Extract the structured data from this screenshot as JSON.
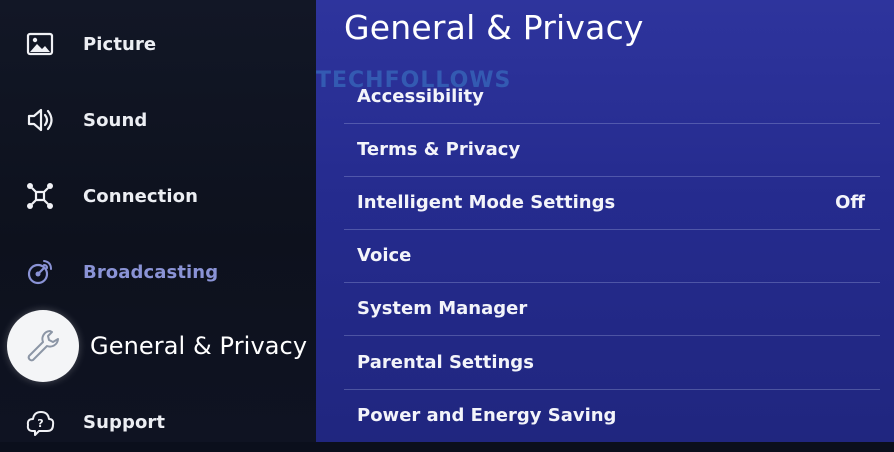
{
  "sidebar": {
    "items": [
      {
        "label": "Picture",
        "icon": "picture-icon"
      },
      {
        "label": "Sound",
        "icon": "speaker-icon"
      },
      {
        "label": "Connection",
        "icon": "network-icon"
      },
      {
        "label": "Broadcasting",
        "icon": "satellite-icon"
      },
      {
        "label": "General & Privacy",
        "icon": "wrench-icon"
      },
      {
        "label": "Support",
        "icon": "help-cloud-icon"
      }
    ]
  },
  "panel": {
    "title": "General & Privacy",
    "watermark": "TECHFOLLOWS",
    "options": [
      {
        "label": "Accessibility",
        "value": ""
      },
      {
        "label": "Terms & Privacy",
        "value": ""
      },
      {
        "label": "Intelligent Mode Settings",
        "value": "Off"
      },
      {
        "label": "Voice",
        "value": ""
      },
      {
        "label": "System Manager",
        "value": ""
      },
      {
        "label": "Parental Settings",
        "value": ""
      },
      {
        "label": "Power and Energy Saving",
        "value": ""
      }
    ]
  },
  "colors": {
    "panel_bg": "#2a309a",
    "sidebar_bg": "#10141f",
    "dim_label": "#8a93d6",
    "active_icon_bg": "#f4f5f7"
  }
}
